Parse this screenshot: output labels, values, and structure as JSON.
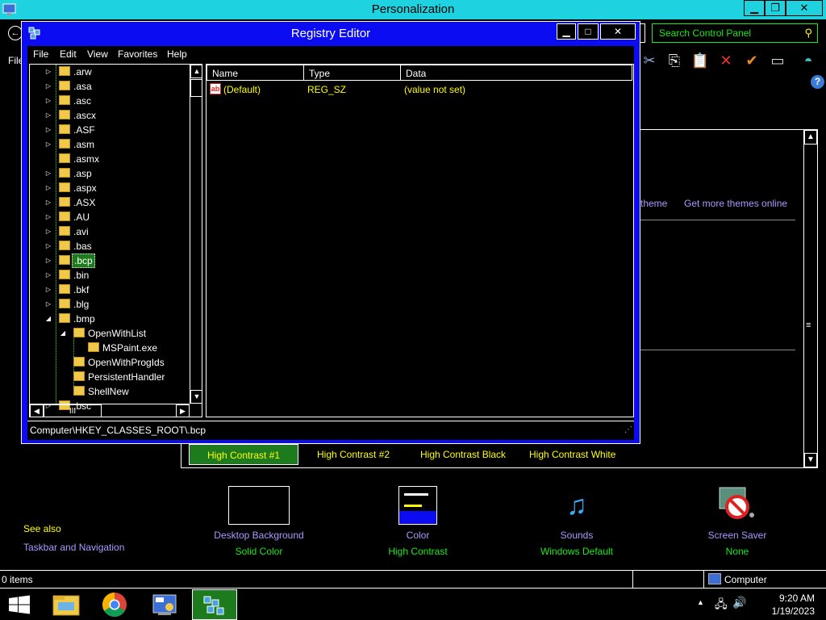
{
  "personalization": {
    "title": "Personalization",
    "menu_file": "File",
    "search_placeholder": "Search Control Panel",
    "links": {
      "theme_partial": "theme",
      "get_more_themes": "Get more themes online"
    },
    "themes": [
      "High Contrast #1",
      "High Contrast #2",
      "High Contrast Black",
      "High Contrast White"
    ],
    "selected_theme": "High Contrast #1",
    "see_also": {
      "heading": "See also",
      "taskbar": "Taskbar and Navigation"
    },
    "bottom_items": [
      {
        "name": "Desktop Background",
        "sub": "Solid Color",
        "icon": "desktop-background-icon"
      },
      {
        "name": "Color",
        "sub": "High Contrast",
        "icon": "color-icon"
      },
      {
        "name": "Sounds",
        "sub": "Windows Default",
        "icon": "sounds-icon"
      },
      {
        "name": "Screen Saver",
        "sub": "None",
        "icon": "screen-saver-icon"
      }
    ],
    "status": {
      "items": "0 items",
      "location": "Computer"
    }
  },
  "regedit": {
    "title": "Registry Editor",
    "menu": [
      "File",
      "Edit",
      "View",
      "Favorites",
      "Help"
    ],
    "tree": [
      {
        "label": ".arw",
        "level": 0,
        "expander": "collapsed"
      },
      {
        "label": ".asa",
        "level": 0,
        "expander": "collapsed"
      },
      {
        "label": ".asc",
        "level": 0,
        "expander": "collapsed"
      },
      {
        "label": ".ascx",
        "level": 0,
        "expander": "collapsed"
      },
      {
        "label": ".ASF",
        "level": 0,
        "expander": "collapsed"
      },
      {
        "label": ".asm",
        "level": 0,
        "expander": "collapsed"
      },
      {
        "label": ".asmx",
        "level": 0,
        "expander": "none"
      },
      {
        "label": ".asp",
        "level": 0,
        "expander": "collapsed"
      },
      {
        "label": ".aspx",
        "level": 0,
        "expander": "collapsed"
      },
      {
        "label": ".ASX",
        "level": 0,
        "expander": "collapsed"
      },
      {
        "label": ".AU",
        "level": 0,
        "expander": "collapsed"
      },
      {
        "label": ".avi",
        "level": 0,
        "expander": "collapsed"
      },
      {
        "label": ".bas",
        "level": 0,
        "expander": "collapsed"
      },
      {
        "label": ".bcp",
        "level": 0,
        "expander": "collapsed",
        "selected": true
      },
      {
        "label": ".bin",
        "level": 0,
        "expander": "collapsed"
      },
      {
        "label": ".bkf",
        "level": 0,
        "expander": "collapsed"
      },
      {
        "label": ".blg",
        "level": 0,
        "expander": "collapsed"
      },
      {
        "label": ".bmp",
        "level": 0,
        "expander": "expanded"
      },
      {
        "label": "OpenWithList",
        "level": 1,
        "expander": "expanded"
      },
      {
        "label": "MSPaint.exe",
        "level": 2,
        "expander": "none"
      },
      {
        "label": "OpenWithProgIds",
        "level": 1,
        "expander": "none"
      },
      {
        "label": "PersistentHandler",
        "level": 1,
        "expander": "none"
      },
      {
        "label": "ShellNew",
        "level": 1,
        "expander": "none"
      },
      {
        "label": ".bsc",
        "level": 0,
        "expander": "collapsed"
      }
    ],
    "columns": [
      "Name",
      "Type",
      "Data"
    ],
    "values": [
      {
        "name": "(Default)",
        "type": "REG_SZ",
        "data": "(value not set)"
      }
    ],
    "status_path": "Computer\\HKEY_CLASSES_ROOT\\.bcp",
    "hscroll_thumb": "III"
  },
  "taskbar": {
    "time": "9:20 AM",
    "date": "1/19/2023",
    "apps": [
      "file-explorer-icon",
      "chrome-icon",
      "control-panel-icon",
      "registry-editor-icon"
    ]
  },
  "colors": {
    "titlebar": "#1fd2e0",
    "regedit_frame": "#0c0cf2",
    "selection": "#1d7a1d",
    "hc_yellow": "#ffff00",
    "hc_green": "#1aeb1a",
    "hc_link": "#a79aff"
  }
}
